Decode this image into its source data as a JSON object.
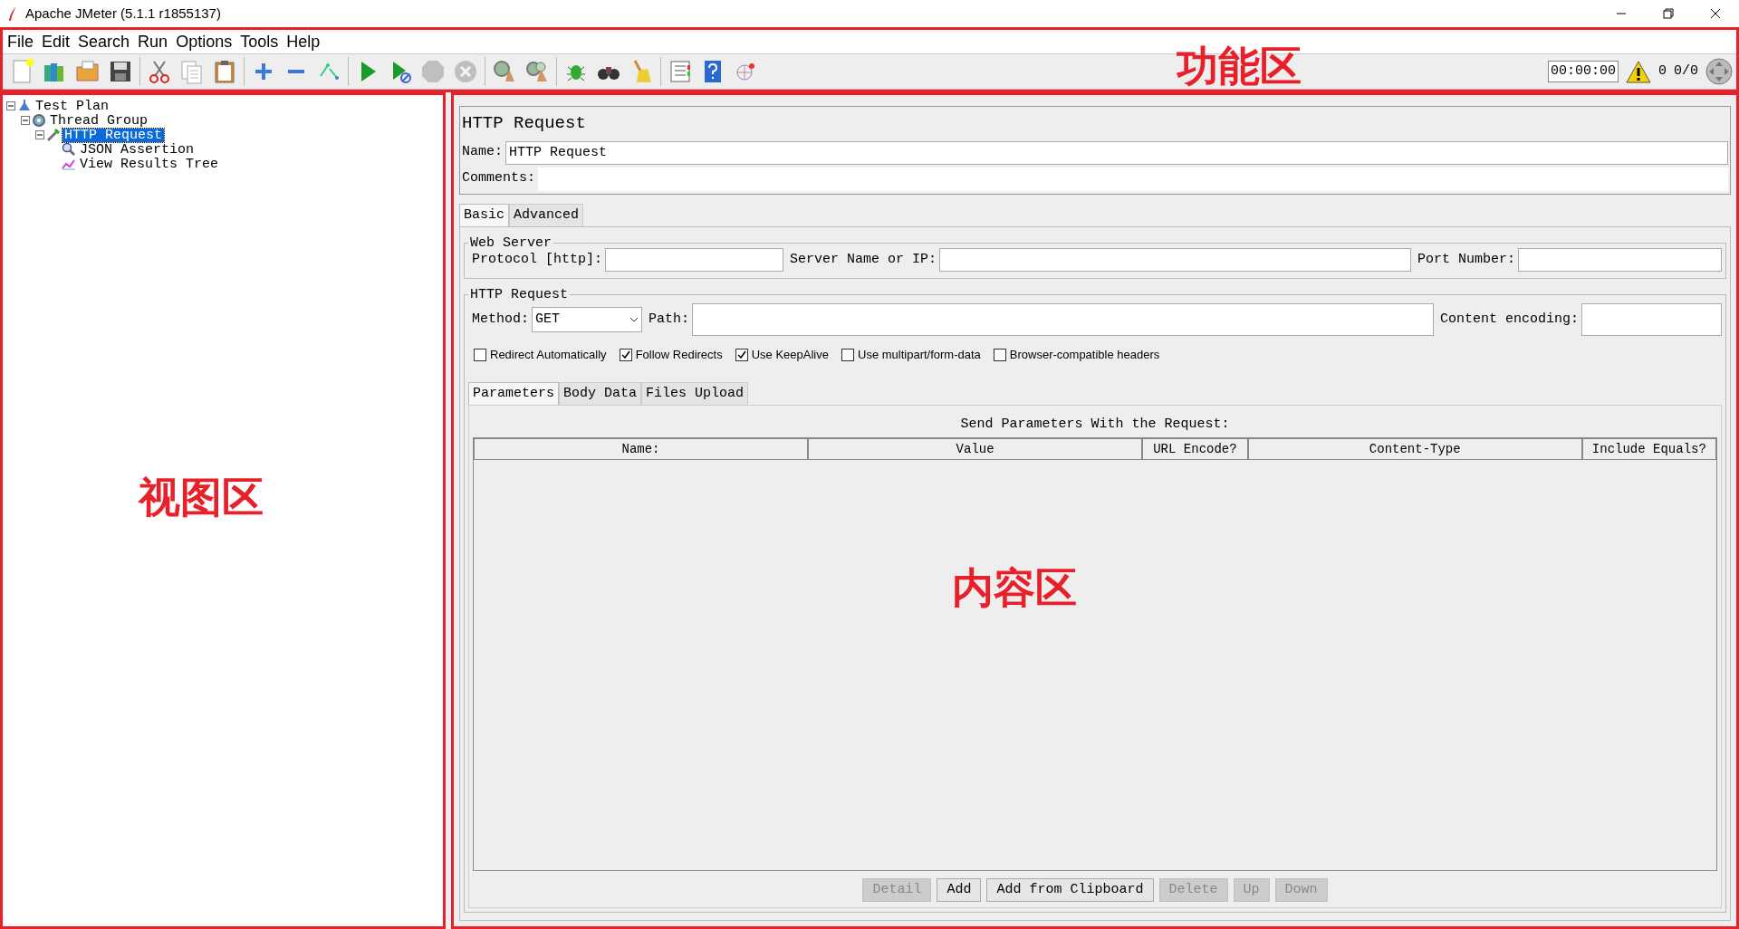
{
  "window": {
    "title": "Apache JMeter (5.1.1 r1855137)"
  },
  "menu": [
    "File",
    "Edit",
    "Search",
    "Run",
    "Options",
    "Tools",
    "Help"
  ],
  "toolbar": [
    {
      "kind": "new",
      "disabled": false
    },
    {
      "kind": "templates",
      "disabled": false
    },
    {
      "kind": "open",
      "disabled": false
    },
    {
      "kind": "save",
      "disabled": false
    },
    {
      "kind": "separator"
    },
    {
      "kind": "cut",
      "disabled": false
    },
    {
      "kind": "copy",
      "disabled": false
    },
    {
      "kind": "paste",
      "disabled": false
    },
    {
      "kind": "separator"
    },
    {
      "kind": "expand",
      "disabled": false
    },
    {
      "kind": "collapse",
      "disabled": false
    },
    {
      "kind": "toggle",
      "disabled": false
    },
    {
      "kind": "separator"
    },
    {
      "kind": "start",
      "disabled": false
    },
    {
      "kind": "start_no_pause",
      "disabled": false
    },
    {
      "kind": "stop",
      "disabled": true
    },
    {
      "kind": "shutdown",
      "disabled": true
    },
    {
      "kind": "separator"
    },
    {
      "kind": "clear",
      "disabled": false
    },
    {
      "kind": "clear_all",
      "disabled": false
    },
    {
      "kind": "separator"
    },
    {
      "kind": "bug",
      "disabled": false
    },
    {
      "kind": "search",
      "disabled": false
    },
    {
      "kind": "broom",
      "disabled": false
    },
    {
      "kind": "separator"
    },
    {
      "kind": "log",
      "disabled": false
    },
    {
      "kind": "help",
      "disabled": false
    },
    {
      "kind": "remote",
      "disabled": false
    }
  ],
  "status": {
    "timer": "00:00:00",
    "warnings": "0",
    "threads": "0/0"
  },
  "tree": [
    {
      "label": "Test Plan",
      "kind": "plan",
      "expanded": true,
      "selected": false,
      "children": [
        {
          "label": "Thread Group",
          "kind": "thread_group",
          "expanded": true,
          "selected": false,
          "children": [
            {
              "label": "HTTP Request",
              "kind": "sampler",
              "expanded": true,
              "selected": true,
              "children": [
                {
                  "label": "JSON Assertion",
                  "kind": "assertion",
                  "selected": false
                },
                {
                  "label": "View Results Tree",
                  "kind": "listener",
                  "selected": false
                }
              ]
            }
          ]
        }
      ]
    }
  ],
  "editor": {
    "title": "HTTP Request",
    "name_label": "Name:",
    "name_value": "HTTP Request",
    "comments_label": "Comments:",
    "tabs": [
      {
        "label": "Basic",
        "selected": true
      },
      {
        "label": "Advanced",
        "selected": false
      }
    ],
    "web_server": {
      "legend": "Web Server",
      "fields": [
        {
          "label": "Protocol [http]:"
        },
        {
          "label": "Server Name or IP:"
        },
        {
          "label": "Port Number:"
        }
      ]
    },
    "http_request": {
      "legend": "HTTP Request",
      "method_label": "Method:",
      "method": "GET",
      "path_label": "Path:",
      "encoding_label": "Content encoding:",
      "options": [
        {
          "label": "Redirect Automatically",
          "checked": false
        },
        {
          "label": "Follow Redirects",
          "checked": true
        },
        {
          "label": "Use KeepAlive",
          "checked": true
        },
        {
          "label": "Use multipart/form-data",
          "checked": false
        },
        {
          "label": "Browser-compatible headers",
          "checked": false
        }
      ]
    },
    "param_tabs": [
      {
        "label": "Parameters",
        "selected": true
      },
      {
        "label": "Body Data",
        "selected": false
      },
      {
        "label": "Files Upload",
        "selected": false
      }
    ],
    "parameters": {
      "caption": "Send Parameters With the Request:",
      "columns": [
        "Name:",
        "Value",
        "URL Encode?",
        "Content-Type",
        "Include Equals?"
      ]
    },
    "buttons": [
      {
        "label": "Detail",
        "disabled": true
      },
      {
        "label": "Add",
        "disabled": false
      },
      {
        "label": "Add from Clipboard",
        "disabled": false
      },
      {
        "label": "Delete",
        "disabled": true
      },
      {
        "label": "Up",
        "disabled": true
      },
      {
        "label": "Down",
        "disabled": true
      }
    ]
  },
  "annotations": [
    {
      "label": "功能区"
    },
    {
      "label": "视图区"
    },
    {
      "label": "内容区"
    }
  ]
}
